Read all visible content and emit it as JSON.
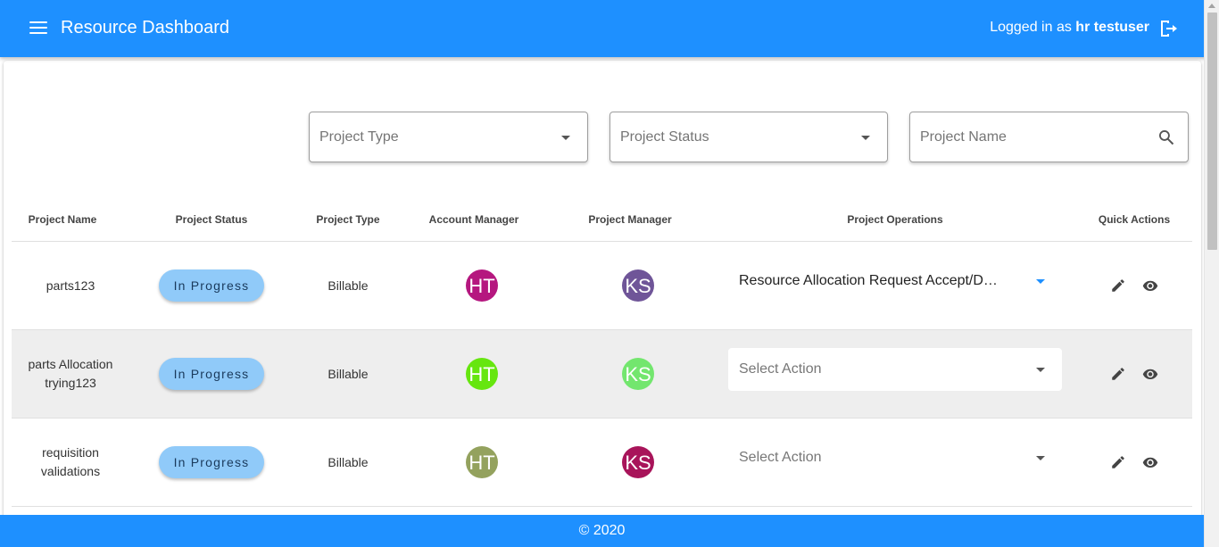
{
  "header": {
    "title": "Resource Dashboard",
    "login_prefix": "Logged in as",
    "username": "hr testuser"
  },
  "filters": {
    "project_type": "Project Type",
    "project_status": "Project Status",
    "project_name": "Project Name"
  },
  "table": {
    "columns": [
      "Project Name",
      "Project Status",
      "Project Type",
      "Account Manager",
      "Project Manager",
      "Project Operations",
      "Quick Actions"
    ],
    "rows": [
      {
        "name": "parts123",
        "status": "In Progress",
        "type": "Billable",
        "account_manager": "HT",
        "account_manager_color": "#b5177f",
        "project_manager": "KS",
        "project_manager_color": "#6f5598",
        "operation": "Resource Allocation Request Accept/D…"
      },
      {
        "name": "parts Allocation trying123",
        "status": "In Progress",
        "type": "Billable",
        "account_manager": "HT",
        "account_manager_color": "#66e60f",
        "project_manager": "KS",
        "project_manager_color": "#73e66e",
        "operation": "Select Action"
      },
      {
        "name": "requisition validations",
        "status": "In Progress",
        "type": "Billable",
        "account_manager": "HT",
        "account_manager_color": "#94a25e",
        "project_manager": "KS",
        "project_manager_color": "#a8145a",
        "operation": "Select Action"
      }
    ]
  },
  "footer": {
    "text": "© 2020"
  },
  "colors": {
    "primary": "#1e90ff",
    "status_chip": "#90caf9"
  }
}
